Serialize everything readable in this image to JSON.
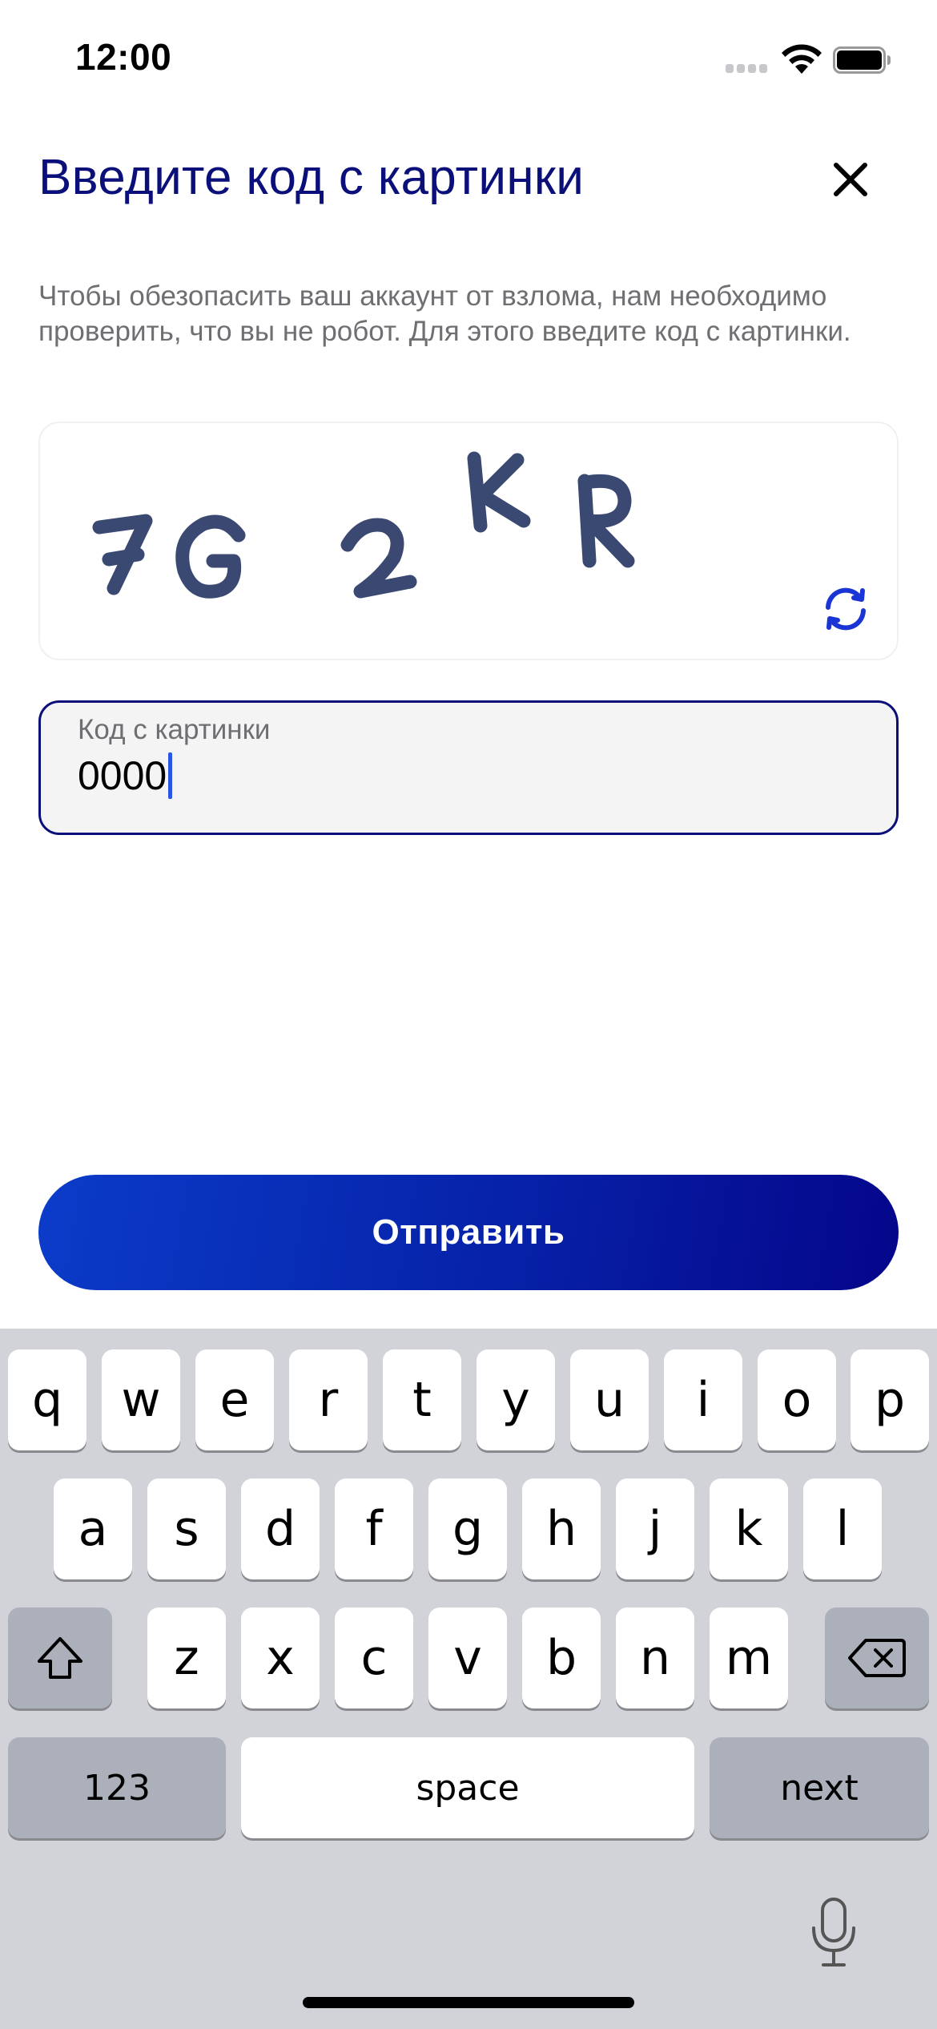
{
  "status_bar": {
    "time": "12:00"
  },
  "header": {
    "title": "Введите код с картинки"
  },
  "description": "Чтобы обезопасить ваш аккаунт от взлома, нам необходимо проверить, что вы не робот. Для этого введите код с картинки.",
  "captcha": {
    "text": "7G2KR"
  },
  "input": {
    "label": "Код с картинки",
    "value": "0000"
  },
  "submit": {
    "label": "Отправить"
  },
  "keyboard": {
    "row1": [
      "q",
      "w",
      "e",
      "r",
      "t",
      "y",
      "u",
      "i",
      "o",
      "p"
    ],
    "row2": [
      "a",
      "s",
      "d",
      "f",
      "g",
      "h",
      "j",
      "k",
      "l"
    ],
    "row3": [
      "z",
      "x",
      "c",
      "v",
      "b",
      "n",
      "m"
    ],
    "numbers_label": "123",
    "space_label": "space",
    "next_label": "next"
  },
  "icons": {
    "close": "close-icon",
    "refresh": "refresh-icon",
    "shift": "shift-icon",
    "backspace": "backspace-icon",
    "mic": "microphone-icon"
  },
  "colors": {
    "accent": "#0a0f7a",
    "button_start": "#0b3cc9",
    "button_end": "#05068a",
    "caret": "#2a55e5"
  }
}
